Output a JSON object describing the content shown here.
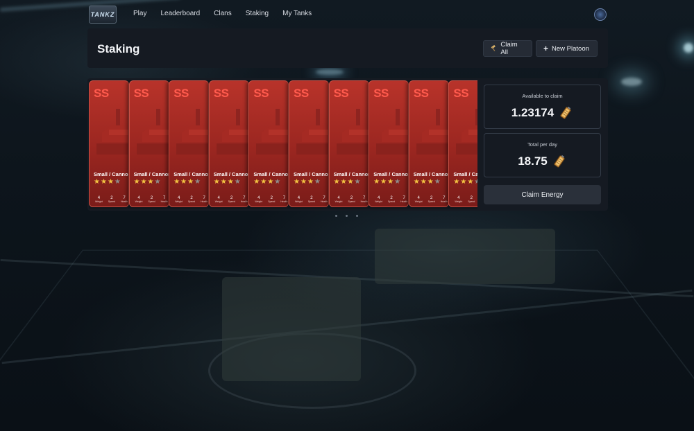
{
  "nav": {
    "logo_text": "TANKZ",
    "links": [
      "Play",
      "Leaderboard",
      "Clans",
      "Staking",
      "My Tanks"
    ]
  },
  "header": {
    "title": "Staking",
    "claim_all_label": "Claim All",
    "new_platoon_label": "New Platoon"
  },
  "cards": [
    {
      "grade": "SS",
      "name": "Small / Cannon",
      "stars": 3,
      "max_stars": 4,
      "stats": [
        {
          "value": "4",
          "label": "Weight"
        },
        {
          "value": "2",
          "label": "Speed"
        },
        {
          "value": "7",
          "label": "Health"
        }
      ]
    },
    {
      "grade": "SS",
      "name": "Small / Cannon",
      "stars": 3,
      "max_stars": 4,
      "stats": [
        {
          "value": "4",
          "label": "Weight"
        },
        {
          "value": "2",
          "label": "Speed"
        },
        {
          "value": "7",
          "label": "Health"
        }
      ]
    },
    {
      "grade": "SS",
      "name": "Small / Cannon",
      "stars": 3,
      "max_stars": 4,
      "stats": [
        {
          "value": "4",
          "label": "Weight"
        },
        {
          "value": "2",
          "label": "Speed"
        },
        {
          "value": "7",
          "label": "Health"
        }
      ]
    },
    {
      "grade": "SS",
      "name": "Small / Cannon",
      "stars": 3,
      "max_stars": 4,
      "stats": [
        {
          "value": "4",
          "label": "Weight"
        },
        {
          "value": "2",
          "label": "Speed"
        },
        {
          "value": "7",
          "label": "Health"
        }
      ]
    },
    {
      "grade": "SS",
      "name": "Small / Cannon",
      "stars": 3,
      "max_stars": 4,
      "stats": [
        {
          "value": "4",
          "label": "Weight"
        },
        {
          "value": "2",
          "label": "Speed"
        },
        {
          "value": "7",
          "label": "Health"
        }
      ]
    },
    {
      "grade": "SS",
      "name": "Small / Cannon",
      "stars": 3,
      "max_stars": 4,
      "stats": [
        {
          "value": "4",
          "label": "Weight"
        },
        {
          "value": "2",
          "label": "Speed"
        },
        {
          "value": "7",
          "label": "Health"
        }
      ]
    },
    {
      "grade": "SS",
      "name": "Small / Cannon",
      "stars": 3,
      "max_stars": 4,
      "stats": [
        {
          "value": "4",
          "label": "Weight"
        },
        {
          "value": "2",
          "label": "Speed"
        },
        {
          "value": "7",
          "label": "Health"
        }
      ]
    },
    {
      "grade": "SS",
      "name": "Small / Cannon",
      "stars": 3,
      "max_stars": 4,
      "stats": [
        {
          "value": "4",
          "label": "Weight"
        },
        {
          "value": "2",
          "label": "Speed"
        },
        {
          "value": "7",
          "label": "Health"
        }
      ]
    },
    {
      "grade": "SS",
      "name": "Small / Cannon",
      "stars": 3,
      "max_stars": 4,
      "stats": [
        {
          "value": "4",
          "label": "Weight"
        },
        {
          "value": "2",
          "label": "Speed"
        },
        {
          "value": "7",
          "label": "Health"
        }
      ]
    },
    {
      "grade": "SS",
      "name": "Small / Cannon",
      "stars": 3,
      "max_stars": 4,
      "stats": [
        {
          "value": "4",
          "label": "Weight"
        },
        {
          "value": "2",
          "label": "Speed"
        },
        {
          "value": "7",
          "label": "Health"
        }
      ]
    }
  ],
  "rewards": {
    "available_label": "Available to claim",
    "available_value": "1.23174",
    "per_day_label": "Total per day",
    "per_day_value": "18.75",
    "claim_energy_label": "Claim Energy",
    "reward_icon": "battery-icon"
  },
  "colors": {
    "card_red": "#b8332a",
    "grade_red": "#ff5a4d",
    "star_gold": "#f3c542",
    "panel_bg": "#151a22"
  }
}
